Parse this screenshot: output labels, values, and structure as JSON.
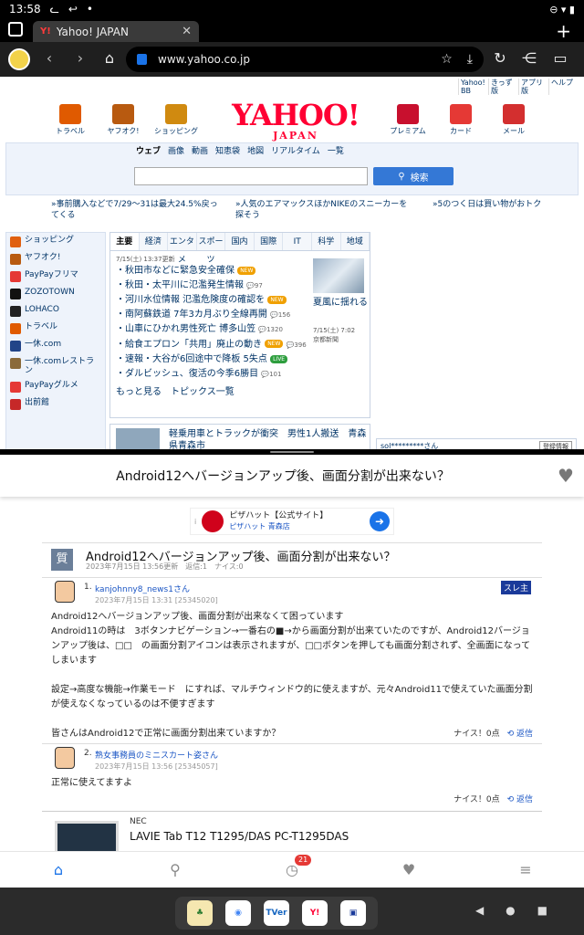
{
  "status": {
    "time": "13:58",
    "left_icons": [
      "cat-icon",
      "back-arrow-icon",
      "dot-icon"
    ],
    "right_icons": "⊖ ▾ ▮"
  },
  "tab": {
    "title": "Yahoo! JAPAN",
    "fav": "Y!"
  },
  "url": "www.yahoo.co.jp",
  "yahoo": {
    "top_links": [
      "Yahoo! BB",
      "きっず版",
      "アプリ版",
      "ヘルプ"
    ],
    "icons_left": [
      {
        "label": "トラベル",
        "color": "#e05a00"
      },
      {
        "label": "ヤフオク!",
        "color": "#b85a10"
      },
      {
        "label": "ショッピング",
        "color": "#d08a10"
      }
    ],
    "icons_right": [
      {
        "label": "プレミアム",
        "color": "#c8102e"
      },
      {
        "label": "カード",
        "color": "#e53935"
      },
      {
        "label": "メール",
        "color": "#d32f2f"
      }
    ],
    "logo": "YAHOO!",
    "logo_sub": "JAPAN",
    "search_tabs": [
      "ウェブ",
      "画像",
      "動画",
      "知恵袋",
      "地図",
      "リアルタイム",
      "一覧"
    ],
    "search_button": "検索",
    "promos": [
      "»事前購入などで7/29〜31は最大24.5%戻ってくる",
      "»人気のエアマックスほかNIKEのスニーカーを探そう",
      "»5のつく日は買い物がおトク"
    ],
    "left_nav": [
      {
        "label": "ショッピング",
        "color": "#e06010"
      },
      {
        "label": "ヤフオク!",
        "color": "#b85a10"
      },
      {
        "label": "PayPayフリマ",
        "color": "#e53935"
      },
      {
        "label": "ZOZOTOWN",
        "color": "#111111"
      },
      {
        "label": "LOHACO",
        "color": "#222222"
      },
      {
        "label": "トラベル",
        "color": "#e05a00"
      },
      {
        "label": "一休.com",
        "color": "#224488"
      },
      {
        "label": "一休.comレストラン",
        "color": "#8a6a3a"
      },
      {
        "label": "PayPayグルメ",
        "color": "#e53935"
      },
      {
        "label": "出前館",
        "color": "#c62828"
      }
    ],
    "news_tabs": [
      "主要",
      "経済",
      "エンタメ",
      "スポーツ",
      "国内",
      "国際",
      "IT",
      "科学",
      "地域"
    ],
    "news_date": "7/15(土) 13:37更新",
    "news": [
      {
        "text": "・秋田市などに緊急安全確保",
        "badge": "NEW",
        "badge_color": "#f0a000",
        "count": ""
      },
      {
        "text": "・秋田・太平川に氾濫発生情報",
        "badge": "",
        "badge_color": "",
        "count": "97"
      },
      {
        "text": "・河川水位情報 氾濫危険度の確認を",
        "badge": "NEW",
        "badge_color": "#f0a000",
        "count": ""
      },
      {
        "text": "・南阿蘇鉄道 7年3カ月ぶり全線再開",
        "badge": "",
        "badge_color": "",
        "count": "156"
      },
      {
        "text": "・山車にひかれ男性死亡 博多山笠",
        "badge": "",
        "badge_color": "",
        "count": "1320"
      },
      {
        "text": "・給食エプロン「共用」廃止の動き",
        "badge": "NEW",
        "badge_color": "#f0a000",
        "count": "396"
      },
      {
        "text": "・速報・大谷が6回途中で降板 5失点",
        "badge": "LIVE",
        "badge_color": "#2e9e3e",
        "count": ""
      },
      {
        "text": "・ダルビッシュ、復活の今季6勝目",
        "badge": "",
        "badge_color": "",
        "count": "101"
      }
    ],
    "news_more": "もっと見る　トピックス一覧",
    "news_side_caption": "夏風に揺れる",
    "news_side_date": "7/15(土) 7:02",
    "news_side_source": "京都新聞",
    "news2": "軽乗用車とトラックが衝突　男性1人搬送　青森県青森市",
    "login_user": "sol*********さん",
    "login_btn": "登録情報"
  },
  "question": {
    "header_title": "Android12へバージョンアップ後、画面分割が出来ない？",
    "icon": "質",
    "title": "Android12へバージョンアップ後、画面分割が出来ない？",
    "meta": "2023年7月15日 13:56更新　返信:1　ナイス:0"
  },
  "ad": {
    "label": "i",
    "title": "ピザハット【公式サイト】",
    "sub": "ピザハット 青森店"
  },
  "answers": [
    {
      "num": "1.",
      "user": "kanjohnny8_news1さん",
      "date": "2023年7月15日 13:31 [25345020]",
      "badge": "スレ主",
      "body": "Android12へバージョンアップ後、画面分割が出来なくて困っています\nAndroid11の時は　3ボタンナビゲーション→一番右の■→から画面分割が出来ていたのですが、Android12バージョンアップ後は、□□　の画面分割アイコンは表示されますが、□□ボタンを押しても画面分割されず、全画面になってしまいます\n\n設定→高度な機能→作業モード　にすれば、マルチウィンドウ的に使えますが、元々Android11で使えていた画面分割が使えなくなっているのは不便すぎます\n\n皆さんはAndroid12で正常に画面分割出来ていますか？",
      "nice": "ナイス！0点",
      "reply": "返信"
    },
    {
      "num": "2.",
      "user": "熟女事務員のミニスカート姿さん",
      "date": "2023年7月15日 13:56 [25345057]",
      "badge": "",
      "body": "正常に使えてますよ",
      "nice": "ナイス！0点",
      "reply": "返信"
    }
  ],
  "product": {
    "brand": "NEC",
    "name": "LAVIE Tab T12 T1295/DAS PC-T1295DAS"
  },
  "bottom_nav": {
    "history_count": "21"
  },
  "dock": [
    {
      "label": "♣",
      "bg": "#f5e7b0",
      "fg": "#2e7d32"
    },
    {
      "label": "◉",
      "bg": "#ffffff",
      "fg": "#4285f4"
    },
    {
      "label": "TVer",
      "bg": "#ffffff",
      "fg": "#1565c0"
    },
    {
      "label": "Y!",
      "bg": "#ffffff",
      "fg": "#ff0033"
    },
    {
      "label": "▣",
      "bg": "#ffffff",
      "fg": "#1a3a9a"
    }
  ]
}
